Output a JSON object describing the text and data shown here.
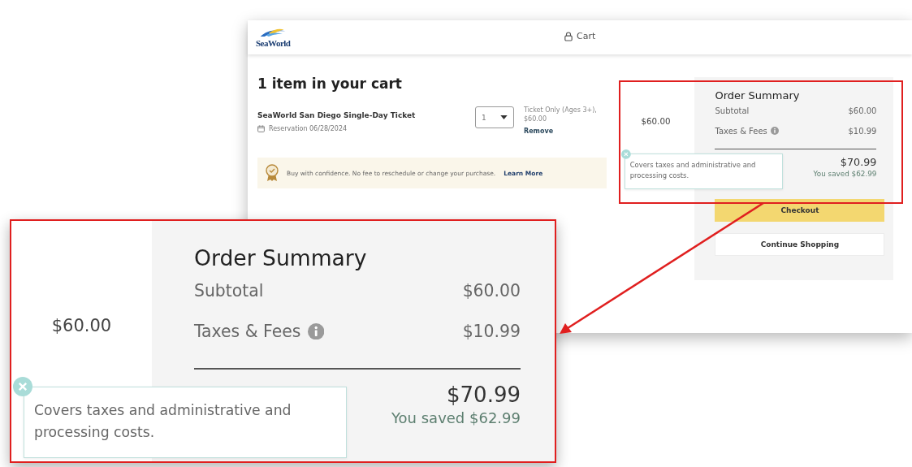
{
  "page": {
    "logo": "SeaWorld",
    "header_title": "Cart",
    "heading": "1 item in your cart",
    "item": {
      "name": "SeaWorld San Diego Single-Day Ticket",
      "reservation": "Reservation 06/28/2024",
      "quantity": "1",
      "ticket_type": "Ticket Only (Ages 3+),",
      "price": "$60.00",
      "remove": "Remove"
    },
    "banner": {
      "text": "Buy with confidence. No fee to reschedule or change your purchase.",
      "link": "Learn More"
    },
    "summary": {
      "side_price": "$60.00",
      "title": "Order Summary",
      "rows": [
        {
          "label": "Subtotal",
          "value": "$60.00",
          "info": false
        },
        {
          "label": "Taxes & Fees",
          "value": "$10.99",
          "info": true
        }
      ],
      "total": "$70.99",
      "saved": "You saved $62.99",
      "tooltip": "Covers taxes and administrative and processing costs."
    },
    "buttons": [
      {
        "label": "Checkout",
        "kind": "primary"
      },
      {
        "label": "Continue Shopping",
        "kind": "secondary"
      }
    ]
  },
  "callout": {
    "side_price": "$60.00",
    "title": "Order Summary",
    "rows": [
      {
        "label": "Subtotal",
        "value": "$60.00",
        "info": false
      },
      {
        "label": "Taxes & Fees",
        "value": "$10.99",
        "info": true
      }
    ],
    "total": "$70.99",
    "saved": "You saved $62.99",
    "tooltip": "Covers taxes and administrative and processing costs."
  }
}
